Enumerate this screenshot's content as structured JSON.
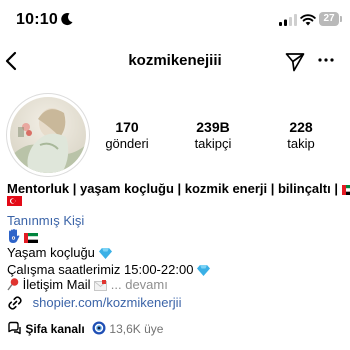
{
  "status_bar": {
    "time": "10:10",
    "battery": "27"
  },
  "header": {
    "username": "kozmikenejiii"
  },
  "stats": {
    "posts_value": "170",
    "posts_label": "gönderi",
    "followers_value": "239B",
    "followers_label": "takipçi",
    "following_value": "228",
    "following_label": "takip"
  },
  "bio": {
    "name": "Mentorluk | yaşam koçluğu  | kozmik enerji | bilinçaltı |",
    "category": "Tanınmış Kişi",
    "coaching": "Yaşam koçluğu ",
    "hours": "Çalışma saatlerimiz 15:00-22:00 ",
    "mail": "İletişim Mail ",
    "more": "... devamı",
    "link": "shopier.com/kozmikenerjii",
    "channel_name": "Şifa kanalı",
    "channel_count": "13,6K üye"
  },
  "icons": {
    "status": [
      "moon-icon",
      "signal-icon",
      "wifi-icon"
    ],
    "header": [
      "back-icon",
      "send-icon",
      "more-icon"
    ],
    "bio": [
      "uae-flag-icon",
      "turkey-flag-icon",
      "hamsa-icon",
      "gem-icon",
      "pushpin-icon",
      "envelope-icon",
      "link-icon",
      "threads-icon",
      "evil-eye-icon"
    ]
  },
  "colors": {
    "link": "#3b64a8",
    "muted": "#8e8e8e",
    "gem": "#3ab0e6"
  }
}
